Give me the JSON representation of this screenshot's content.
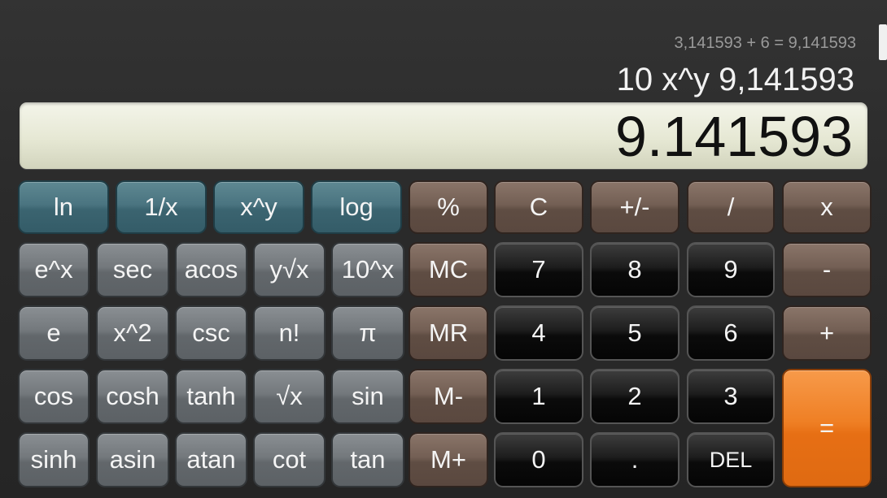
{
  "history_line": "3,141593 + 6 = 9,141593",
  "expression_line": "10 x^y 9,141593",
  "display_value": "9.141593",
  "keys": {
    "ln": "ln",
    "reciprocal": "1/x",
    "x_pow_y": "x^y",
    "log": "log",
    "percent": "%",
    "clear": "C",
    "plus_minus": "+/-",
    "divide": "/",
    "multiply": "x",
    "e_pow_x": "e^x",
    "sec": "sec",
    "acos": "acos",
    "y_root_x": "y√x",
    "ten_pow_x": "10^x",
    "mc": "MC",
    "seven": "7",
    "eight": "8",
    "nine": "9",
    "minus": "-",
    "e": "e",
    "x_squared": "x^2",
    "csc": "csc",
    "factorial": "n!",
    "pi": "π",
    "mr": "MR",
    "four": "4",
    "five": "5",
    "six": "6",
    "plus": "+",
    "cos": "cos",
    "cosh": "cosh",
    "tanh": "tanh",
    "sqrt": "√x",
    "sin": "sin",
    "m_minus": "M-",
    "one": "1",
    "two": "2",
    "three": "3",
    "equals": "=",
    "sinh": "sinh",
    "asin": "asin",
    "atan": "atan",
    "cot": "cot",
    "tan": "tan",
    "m_plus": "M+",
    "zero": "0",
    "decimal": ".",
    "delete": "DEL"
  }
}
